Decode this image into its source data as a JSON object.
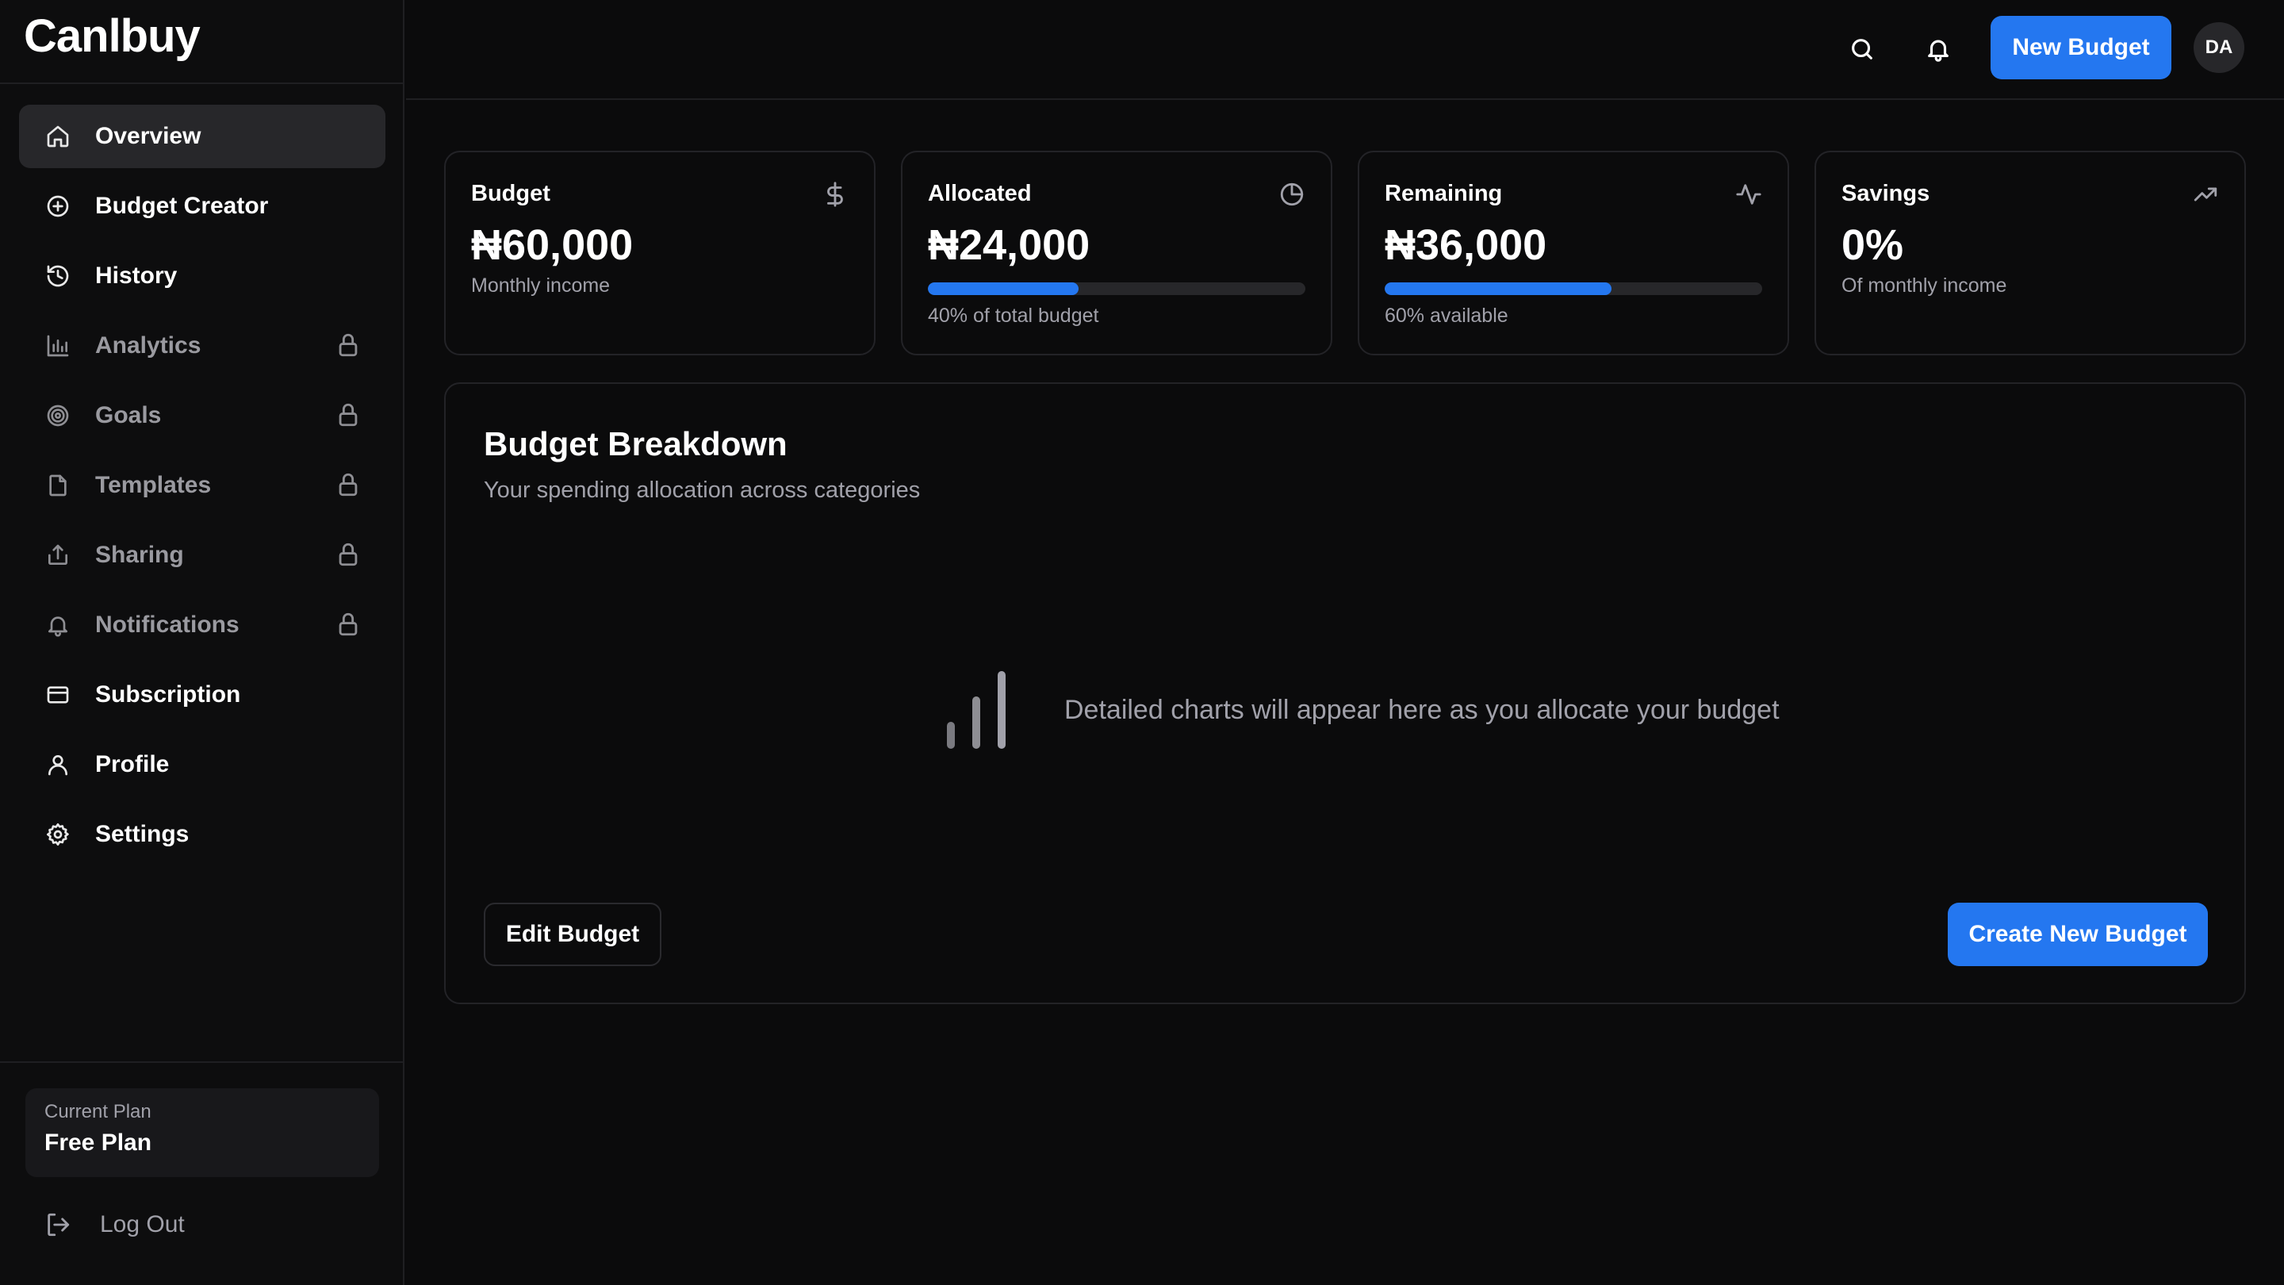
{
  "app": {
    "logo": "Canlbuy"
  },
  "sidebar": {
    "items": [
      {
        "label": "Overview",
        "icon": "home-icon",
        "active": true,
        "locked": false
      },
      {
        "label": "Budget Creator",
        "icon": "plus-circle-icon",
        "active": false,
        "locked": false
      },
      {
        "label": "History",
        "icon": "history-icon",
        "active": false,
        "locked": false
      },
      {
        "label": "Analytics",
        "icon": "bar-chart-icon",
        "active": false,
        "locked": true
      },
      {
        "label": "Goals",
        "icon": "target-icon",
        "active": false,
        "locked": true
      },
      {
        "label": "Templates",
        "icon": "file-icon",
        "active": false,
        "locked": true
      },
      {
        "label": "Sharing",
        "icon": "share-icon",
        "active": false,
        "locked": true
      },
      {
        "label": "Notifications",
        "icon": "bell-icon",
        "active": false,
        "locked": true
      },
      {
        "label": "Subscription",
        "icon": "credit-card-icon",
        "active": false,
        "locked": false
      },
      {
        "label": "Profile",
        "icon": "user-icon",
        "active": false,
        "locked": false
      },
      {
        "label": "Settings",
        "icon": "gear-icon",
        "active": false,
        "locked": false
      }
    ],
    "plan": {
      "label": "Current Plan",
      "name": "Free Plan"
    },
    "logout": "Log Out"
  },
  "header": {
    "new_budget": "New Budget",
    "avatar_initials": "DA"
  },
  "cards": {
    "budget": {
      "title": "Budget",
      "value": "₦60,000",
      "sub": "Monthly income",
      "icon": "dollar-icon"
    },
    "allocated": {
      "title": "Allocated",
      "value": "₦24,000",
      "sub": "40% of total budget",
      "progress": 0.4,
      "icon": "pie-chart-icon"
    },
    "remaining": {
      "title": "Remaining",
      "value": "₦36,000",
      "sub": "60% available",
      "progress": 0.6,
      "icon": "activity-icon"
    },
    "savings": {
      "title": "Savings",
      "value": "0%",
      "sub": "Of monthly income",
      "icon": "trending-up-icon"
    }
  },
  "breakdown": {
    "title": "Budget Breakdown",
    "subtitle": "Your spending allocation across categories",
    "empty_message": "Detailed charts will appear here as you allocate your budget",
    "edit_button": "Edit Budget",
    "create_button": "Create New Budget"
  },
  "colors": {
    "accent": "#2477f0",
    "background": "#0b0b0c",
    "muted": "#a1a1aa"
  }
}
